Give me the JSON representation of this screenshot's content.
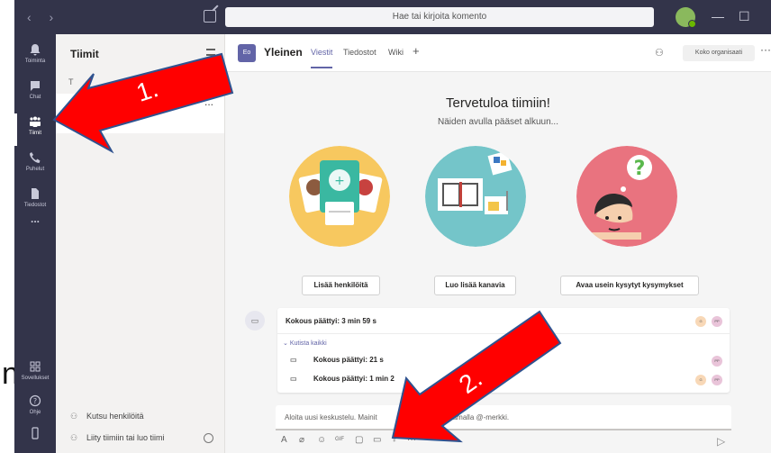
{
  "search": {
    "placeholder": "Hae tai kirjoita komento"
  },
  "rail": {
    "items": [
      {
        "label": "Toiminta",
        "icon": "bell-icon"
      },
      {
        "label": "Chat",
        "icon": "chat-icon"
      },
      {
        "label": "Tiimit",
        "icon": "teams-icon"
      },
      {
        "label": "Puhelut",
        "icon": "phone-icon"
      },
      {
        "label": "Tiedostot",
        "icon": "file-icon"
      }
    ],
    "more": "...",
    "apps_label": "Sovellukset",
    "help_label": "Ohje"
  },
  "teams_pane": {
    "title": "Tiimit",
    "team_initial": "T",
    "more": "...",
    "invite_label": "Kutsu henkilöitä",
    "join_label": "Liity tiimiin tai luo tiimi"
  },
  "channel": {
    "avatar": "Eo",
    "name": "Yleinen",
    "tabs": [
      "Viestit",
      "Tiedostot",
      "Wiki"
    ],
    "add_tab": "+",
    "org_button": "Koko organisaati",
    "more": "···"
  },
  "welcome": {
    "title": "Tervetuloa tiimiin!",
    "subtitle": "Näiden avulla pääset alkuun...",
    "buttons": [
      "Lisää henkilöitä",
      "Luo lisää kanavia",
      "Avaa usein kysytyt kysymykset"
    ]
  },
  "conversation": {
    "main_item": "Kokous päättyi: 3 min 59 s",
    "collapse": "Kutista kaikki",
    "replies": [
      "Kokous päättyi: 21 s",
      "Kokous päättyi: 1 min 2"
    ],
    "avatars": {
      "g": "G",
      "pp": "PP"
    }
  },
  "compose": {
    "placeholder_left": "Aloita uusi keskustelu. Mainit",
    "placeholder_right": "amalla @-merkki."
  },
  "annotations": {
    "arrow1_label": "1.",
    "arrow2_label": "2."
  },
  "colors": {
    "rail": "#33344a",
    "accent": "#6264a7",
    "arrow_red": "#ff0000"
  }
}
